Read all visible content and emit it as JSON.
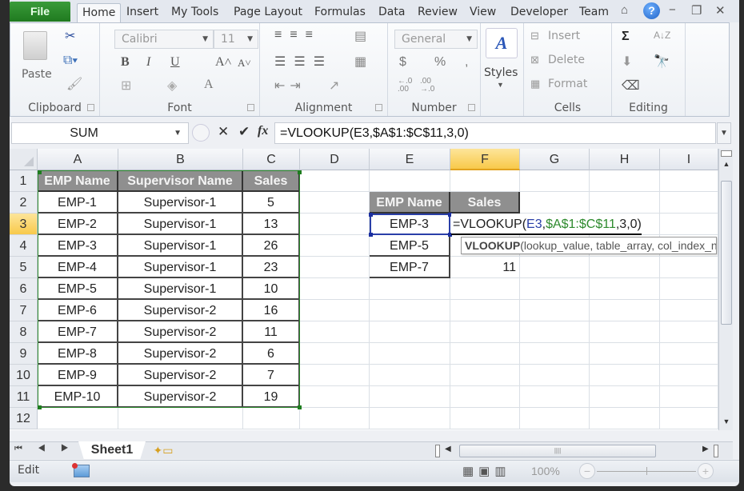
{
  "tabs": {
    "file": "File",
    "items": [
      "Home",
      "Insert",
      "My Tools",
      "Page Layout",
      "Formulas",
      "Data",
      "Review",
      "View",
      "Developer",
      "Team"
    ],
    "active": "Home"
  },
  "window_controls": {
    "minimize_ribbon": "⌂",
    "help": "?",
    "minimize": "−",
    "restore": "❐",
    "close": "✕"
  },
  "ribbon": {
    "clipboard": {
      "label": "Clipboard",
      "paste": "Paste"
    },
    "font": {
      "label": "Font",
      "name": "Calibri",
      "size": "11",
      "bold": "B",
      "italic": "I",
      "underline": "U",
      "grow": "A˄",
      "shrink": "A˅",
      "color": "A"
    },
    "alignment": {
      "label": "Alignment"
    },
    "number": {
      "label": "Number",
      "format": "General",
      "currency": "$",
      "percent": "%",
      "comma": ",",
      "inc_decimal": "←.0\n.00",
      "dec_decimal": ".00\n→.0"
    },
    "styles": {
      "label": "Styles"
    },
    "cells": {
      "label": "Cells",
      "insert": "Insert",
      "delete": "Delete",
      "format": "Format"
    },
    "editing": {
      "label": "Editing",
      "autosum": "Σ",
      "sort": "A↓Z"
    }
  },
  "formula_bar": {
    "name_box": "SUM",
    "cancel": "✕",
    "enter": "✔",
    "fx": "fx",
    "formula": "=VLOOKUP(E3,$A$1:$C$11,3,0)"
  },
  "grid": {
    "columns": [
      "A",
      "B",
      "C",
      "D",
      "E",
      "F",
      "G",
      "H",
      "I"
    ],
    "selected_column": "F",
    "rows": [
      "1",
      "2",
      "3",
      "4",
      "5",
      "6",
      "7",
      "8",
      "9",
      "10",
      "11",
      "12"
    ],
    "selected_row": "3",
    "table1": {
      "headers": [
        "EMP Name",
        "Supervisor Name",
        "Sales"
      ],
      "rows": [
        [
          "EMP-1",
          "Supervisor-1",
          "5"
        ],
        [
          "EMP-2",
          "Supervisor-1",
          "13"
        ],
        [
          "EMP-3",
          "Supervisor-1",
          "26"
        ],
        [
          "EMP-4",
          "Supervisor-1",
          "23"
        ],
        [
          "EMP-5",
          "Supervisor-1",
          "10"
        ],
        [
          "EMP-6",
          "Supervisor-2",
          "16"
        ],
        [
          "EMP-7",
          "Supervisor-2",
          "11"
        ],
        [
          "EMP-8",
          "Supervisor-2",
          "6"
        ],
        [
          "EMP-9",
          "Supervisor-2",
          "7"
        ],
        [
          "EMP-10",
          "Supervisor-2",
          "19"
        ]
      ]
    },
    "table2": {
      "headers": [
        "EMP Name",
        "Sales"
      ],
      "rows": [
        [
          "EMP-3",
          ""
        ],
        [
          "EMP-5",
          ""
        ],
        [
          "EMP-7",
          "11"
        ]
      ]
    },
    "edit": {
      "prefix": "=VLOOKUP(",
      "ref1": "E3",
      "sep1": ",",
      "ref2": "$A$1:$C$11",
      "suffix": ",3,0)"
    },
    "tooltip": {
      "func": "VLOOKUP",
      "args": "(lookup_value, table_array, col_index_num, [range_lookup])"
    }
  },
  "sheets": {
    "items": [
      "Sheet1"
    ],
    "active": "Sheet1",
    "nav": "⏮ ◀ ▶ ⏭"
  },
  "status": {
    "mode": "Edit",
    "zoom": "100%",
    "view_icons": "▦▣▥"
  }
}
